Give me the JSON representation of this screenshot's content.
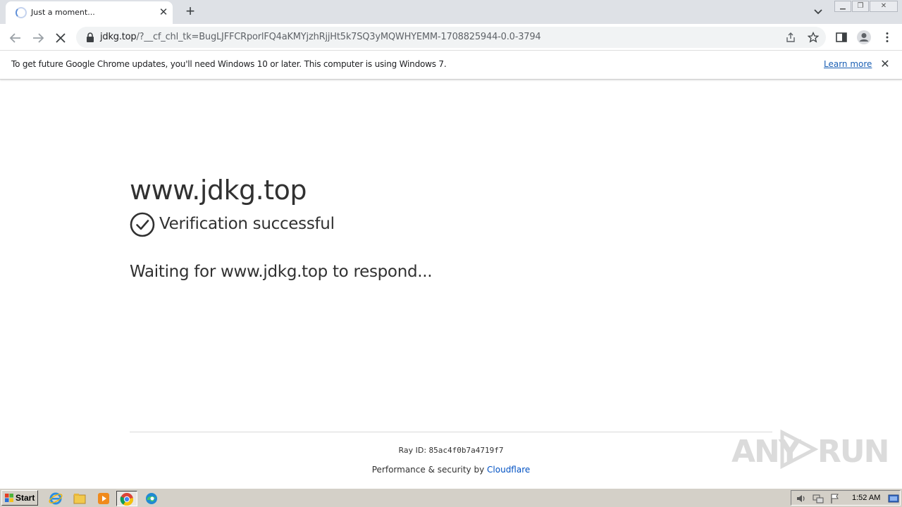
{
  "browser": {
    "tab": {
      "title": "Just a moment..."
    },
    "address": {
      "domain": "jdkg.top",
      "path": "/?__cf_chl_tk=BugLJFFCRporlFQ4aKMYjzhRjjHt5k7SQ3yMQWHYEMM-1708825944-0.0-3794"
    }
  },
  "infobar": {
    "message": "To get future Google Chrome updates, you'll need Windows 10 or later. This computer is using Windows 7.",
    "link_label": "Learn more"
  },
  "page": {
    "site_title": "www.jdkg.top",
    "verification": "Verification successful",
    "waiting": "Waiting for www.jdkg.top to respond...",
    "ray_label": "Ray ID:",
    "ray_id": "85ac4f0b7a4719f7",
    "perf_label": "Performance & security by",
    "provider": "Cloudflare"
  },
  "watermark": {
    "left": "ANY",
    "right": "RUN"
  },
  "taskbar": {
    "start_label": "Start",
    "clock": "1:52 AM"
  },
  "colors": {
    "link": "#0051c3",
    "text": "#313131",
    "taskbar": "#d4d0c8"
  }
}
